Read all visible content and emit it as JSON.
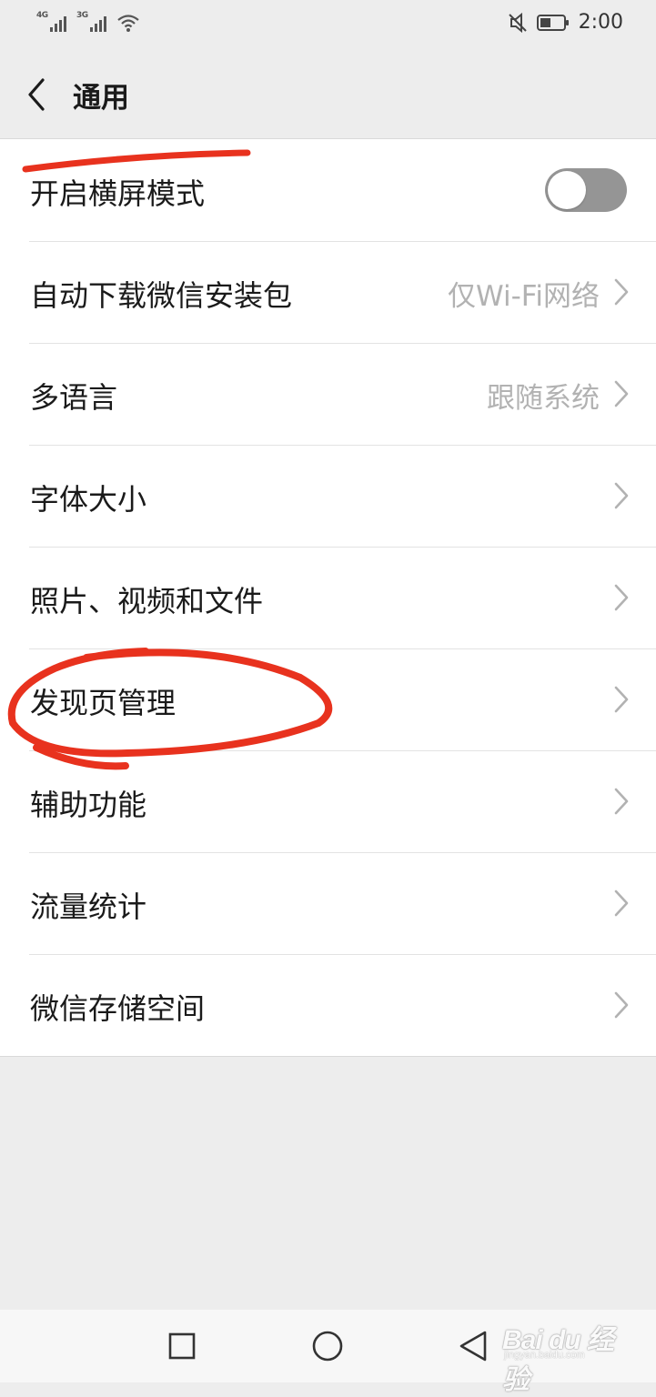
{
  "status_bar": {
    "network_1": "4G",
    "network_2": "3G",
    "time": "2:00"
  },
  "header": {
    "title": "通用"
  },
  "settings": {
    "items": [
      {
        "label": "开启横屏模式",
        "type": "toggle",
        "toggle_on": false
      },
      {
        "label": "自动下载微信安装包",
        "value": "仅Wi-Fi网络",
        "type": "link"
      },
      {
        "label": "多语言",
        "value": "跟随系统",
        "type": "link"
      },
      {
        "label": "字体大小",
        "value": "",
        "type": "link"
      },
      {
        "label": "照片、视频和文件",
        "value": "",
        "type": "link"
      },
      {
        "label": "发现页管理",
        "value": "",
        "type": "link"
      },
      {
        "label": "辅助功能",
        "value": "",
        "type": "link"
      },
      {
        "label": "流量统计",
        "value": "",
        "type": "link"
      },
      {
        "label": "微信存储空间",
        "value": "",
        "type": "link"
      }
    ]
  },
  "nav_bar": {
    "buttons": [
      "recents-square-icon",
      "home-circle-icon",
      "back-triangle-icon"
    ]
  },
  "watermark": {
    "brand": "Bai du 经验",
    "url": "jingyan.baidu.com"
  },
  "colors": {
    "annotation": "#e8321e",
    "toggle_off": "#959595",
    "secondary_text": "#b2b2b2",
    "background": "#ededed"
  }
}
